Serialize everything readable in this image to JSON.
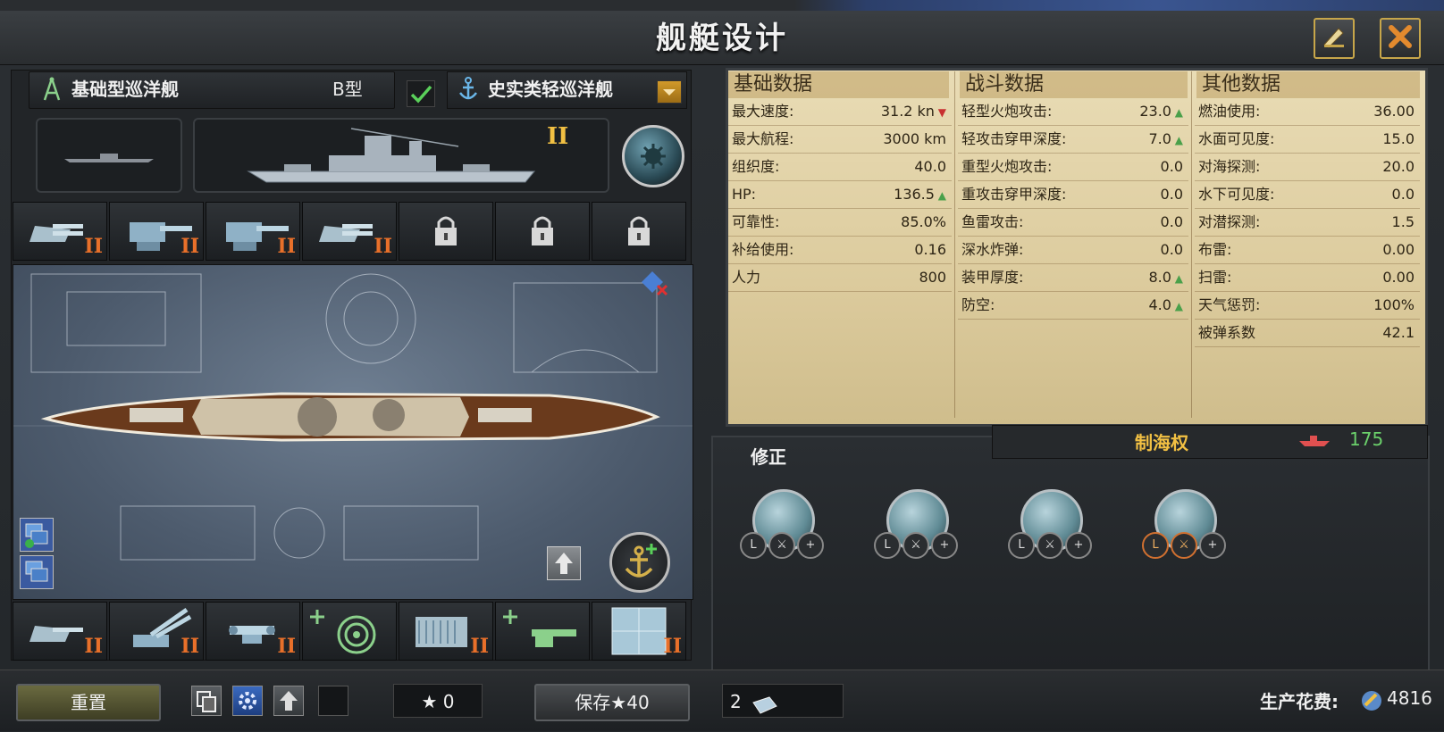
{
  "window": {
    "title": "舰艇设计"
  },
  "design": {
    "hull_name": "基础型巡洋舰",
    "hull_type": "B型",
    "role_name": "史实类轻巡洋舰",
    "tier": "II"
  },
  "modules_top": [
    {
      "name": "heavy-turret",
      "tier": "II",
      "locked": false
    },
    {
      "name": "heavy-gun",
      "tier": "II",
      "locked": false
    },
    {
      "name": "heavy-gun",
      "tier": "II",
      "locked": false
    },
    {
      "name": "heavy-turret",
      "tier": "II",
      "locked": false
    },
    {
      "name": "locked",
      "tier": "",
      "locked": true
    },
    {
      "name": "locked",
      "tier": "",
      "locked": true
    },
    {
      "name": "locked",
      "tier": "",
      "locked": true
    }
  ],
  "modules_bottom": [
    {
      "name": "turret",
      "tier": "II"
    },
    {
      "name": "aa-gun",
      "tier": "II"
    },
    {
      "name": "fire-control",
      "tier": "II"
    },
    {
      "name": "add-radar",
      "tier": ""
    },
    {
      "name": "engine",
      "tier": "II"
    },
    {
      "name": "add-gun",
      "tier": ""
    },
    {
      "name": "armor",
      "tier": "II"
    }
  ],
  "stats": {
    "columns": [
      "基础数据",
      "战斗数据",
      "其他数据"
    ],
    "basic": [
      {
        "label": "最大速度:",
        "value": "31.2 kn",
        "trend": "down"
      },
      {
        "label": "最大航程:",
        "value": "3000 km",
        "trend": ""
      },
      {
        "label": "组织度:",
        "value": "40.0",
        "trend": ""
      },
      {
        "label": "HP:",
        "value": "136.5",
        "trend": "up"
      },
      {
        "label": "可靠性:",
        "value": "85.0%",
        "trend": ""
      },
      {
        "label": "补给使用:",
        "value": "0.16",
        "trend": ""
      },
      {
        "label": "人力",
        "value": "800",
        "trend": ""
      }
    ],
    "combat": [
      {
        "label": "轻型火炮攻击:",
        "value": "23.0",
        "trend": "up"
      },
      {
        "label": "轻攻击穿甲深度:",
        "value": "7.0",
        "trend": "up"
      },
      {
        "label": "重型火炮攻击:",
        "value": "0.0",
        "trend": ""
      },
      {
        "label": "重攻击穿甲深度:",
        "value": "0.0",
        "trend": ""
      },
      {
        "label": "鱼雷攻击:",
        "value": "0.0",
        "trend": ""
      },
      {
        "label": "深水炸弹:",
        "value": "0.0",
        "trend": ""
      },
      {
        "label": "装甲厚度:",
        "value": "8.0",
        "trend": "up"
      },
      {
        "label": "防空:",
        "value": "4.0",
        "trend": "up"
      }
    ],
    "other": [
      {
        "label": "燃油使用:",
        "value": "36.00",
        "trend": ""
      },
      {
        "label": "水面可见度:",
        "value": "15.0",
        "trend": ""
      },
      {
        "label": "对海探测:",
        "value": "20.0",
        "trend": ""
      },
      {
        "label": "水下可见度:",
        "value": "0.0",
        "trend": ""
      },
      {
        "label": "对潜探测:",
        "value": "1.5",
        "trend": ""
      },
      {
        "label": "布雷:",
        "value": "0.00",
        "trend": ""
      },
      {
        "label": "扫雷:",
        "value": "0.00",
        "trend": ""
      },
      {
        "label": "天气惩罚:",
        "value": "100%",
        "trend": ""
      },
      {
        "label": "被弹系数",
        "value": "42.1",
        "trend": ""
      }
    ]
  },
  "modifiers": {
    "title": "修正",
    "tab_label": "制海权",
    "tab_value": "175",
    "items": [
      {
        "name": "terrain-river"
      },
      {
        "name": "terrain-coast"
      },
      {
        "name": "terrain-mountain"
      },
      {
        "name": "terrain-snow"
      }
    ]
  },
  "bottom": {
    "reset_label": "重置",
    "star_value": "★ 0",
    "save_label": "保存★40",
    "count_value": "2",
    "production_label": "生产花费:",
    "production_value": "4816"
  },
  "colors": {
    "accent_gold": "#c7a64a",
    "tier_orange": "#e8702a",
    "stat_up": "#4aa04a",
    "stat_down": "#c83030",
    "modifier_tab": "#f2c043",
    "modifier_value": "#6bd06b"
  }
}
